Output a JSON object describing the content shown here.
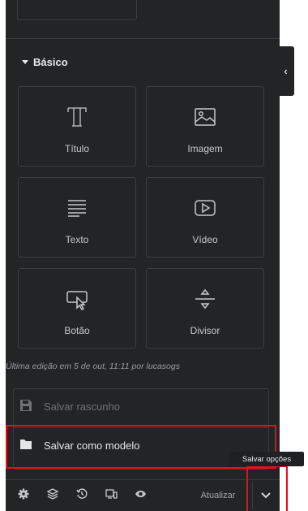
{
  "section": {
    "title": "Básico"
  },
  "collapse_tab": {
    "glyph": "‹"
  },
  "widgets": [
    {
      "label": "Título",
      "icon": "title-icon"
    },
    {
      "label": "Imagem",
      "icon": "image-icon"
    },
    {
      "label": "Texto",
      "icon": "text-editor-icon"
    },
    {
      "label": "Vídeo",
      "icon": "video-icon"
    },
    {
      "label": "Botão",
      "icon": "button-icon"
    },
    {
      "label": "Divisor",
      "icon": "divider-icon"
    }
  ],
  "last_edit": "Última edição em 5 de out, 11:11 por lucasogs",
  "save_menu": {
    "draft_label": "Salvar rascunho",
    "template_label": "Salvar como modelo"
  },
  "footer": {
    "icons": [
      "settings-icon",
      "navigator-icon",
      "history-icon",
      "responsive-icon",
      "preview-icon"
    ],
    "update_label": "Atualizar",
    "options_icon": "chevron-down-icon"
  },
  "tooltip": "Salvar opções",
  "colors": {
    "panel_bg": "#232426",
    "border": "#3b3d40",
    "text": "#c7c8ca",
    "highlight": "#e0121b"
  }
}
